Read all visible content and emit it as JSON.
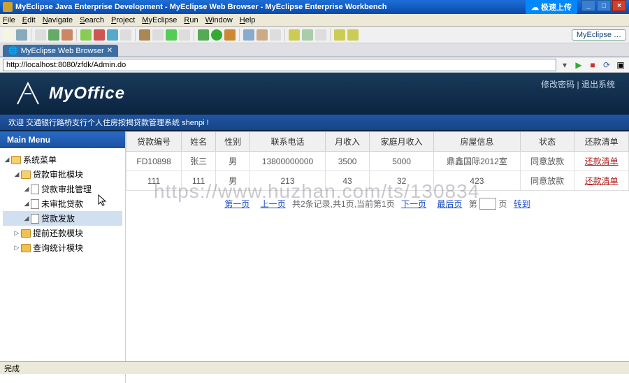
{
  "window": {
    "title": "MyEclipse Java Enterprise Development - MyEclipse Web Browser - MyEclipse Enterprise Workbench",
    "upload_label": "极速上传"
  },
  "menubar": [
    "File",
    "Edit",
    "Navigate",
    "Search",
    "Project",
    "MyEclipse",
    "Run",
    "Window",
    "Help"
  ],
  "toolbar": {
    "badge": "MyEclipse …"
  },
  "tab": {
    "title": "MyEclipse Web Browser"
  },
  "url": "http://localhost:8080/zfdk/Admin.do",
  "app_header": {
    "logo": "MyOffice",
    "link_changepw": "修改密码",
    "link_logout": "退出系统"
  },
  "welcome": "欢迎 交通银行路桥支行个人住房按揭贷款管理系统 shenpi !",
  "sidebar": {
    "title": "Main Menu",
    "root": "系统菜单",
    "items": [
      {
        "label": "贷款审批模块",
        "children": [
          {
            "label": "贷款审批管理"
          },
          {
            "label": "未审批贷款"
          },
          {
            "label": "贷款发放",
            "selected": true
          }
        ]
      },
      {
        "label": "提前还款模块"
      },
      {
        "label": "查询统计模块"
      }
    ]
  },
  "table": {
    "headers": [
      "贷款编号",
      "姓名",
      "性别",
      "联系电话",
      "月收入",
      "家庭月收入",
      "房屋信息",
      "状态",
      "还款清单"
    ],
    "rows": [
      {
        "id": "FD10898",
        "name": "张三",
        "gender": "男",
        "phone": "13800000000",
        "income": "3500",
        "family_income": "5000",
        "house": "鼎鑫国际2012室",
        "status": "同意放款",
        "action": "还款清单"
      },
      {
        "id": "111",
        "name": "111",
        "gender": "男",
        "phone": "213",
        "income": "43",
        "family_income": "32",
        "house": "423",
        "status": "同意放款",
        "action": "还款清单"
      }
    ]
  },
  "pager": {
    "info": "共2条记录,共1页,当前第1页",
    "first": "第一页",
    "prev": "上一页",
    "next": "下一页",
    "last": "最后页",
    "page_prefix": "第",
    "page_suffix": "页",
    "go": "转到"
  },
  "watermark": "https://www.huzhan.com/ts/130834",
  "status": "完成"
}
